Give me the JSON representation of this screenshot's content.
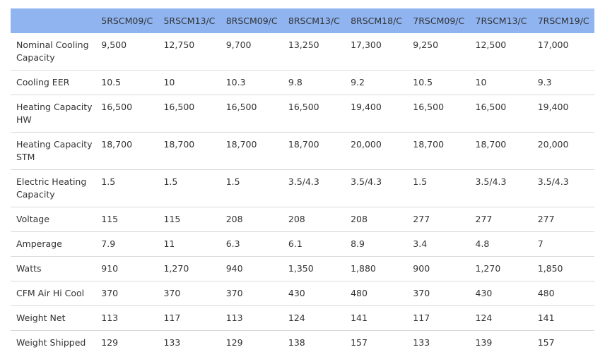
{
  "table": {
    "columns": [
      "",
      "5RSCM09/C",
      "5RSCM13/C",
      "8RSCM09/C",
      "8RSCM13/C",
      "8RSCM18/C",
      "7RSCM09/C",
      "7RSCM13/C",
      "7RSCM19/C"
    ],
    "rows": [
      {
        "label": "Nominal Cooling Capacity",
        "values": [
          "9,500",
          "12,750",
          "9,700",
          "13,250",
          "17,300",
          "9,250",
          "12,500",
          "17,000"
        ]
      },
      {
        "label": "Cooling EER",
        "values": [
          "10.5",
          "10",
          "10.3",
          "9.8",
          "9.2",
          "10.5",
          "10",
          "9.3"
        ]
      },
      {
        "label": "Heating Capacity HW",
        "values": [
          "16,500",
          "16,500",
          "16,500",
          "16,500",
          "19,400",
          "16,500",
          "16,500",
          "19,400"
        ]
      },
      {
        "label": "Heating Capacity STM",
        "values": [
          "18,700",
          "18,700",
          "18,700",
          "18,700",
          "20,000",
          "18,700",
          "18,700",
          "20,000"
        ]
      },
      {
        "label": "Electric Heating Capacity",
        "values": [
          "1.5",
          "1.5",
          "1.5",
          "3.5/4.3",
          "3.5/4.3",
          "1.5",
          "3.5/4.3",
          "3.5/4.3"
        ]
      },
      {
        "label": "Voltage",
        "values": [
          "115",
          "115",
          "208",
          "208",
          "208",
          "277",
          "277",
          "277"
        ]
      },
      {
        "label": "Amperage",
        "values": [
          "7.9",
          "11",
          "6.3",
          "6.1",
          "8.9",
          "3.4",
          "4.8",
          "7"
        ]
      },
      {
        "label": "Watts",
        "values": [
          "910",
          "1,270",
          "940",
          "1,350",
          "1,880",
          "900",
          "1,270",
          "1,850"
        ]
      },
      {
        "label": "CFM Air Hi Cool",
        "values": [
          "370",
          "370",
          "370",
          "430",
          "480",
          "370",
          "430",
          "480"
        ]
      },
      {
        "label": "Weight Net",
        "values": [
          "113",
          "117",
          "113",
          "124",
          "141",
          "117",
          "124",
          "141"
        ]
      },
      {
        "label": "Weight Shipped",
        "values": [
          "129",
          "133",
          "129",
          "138",
          "157",
          "133",
          "139",
          "157"
        ]
      }
    ]
  },
  "colors": {
    "header_bg": "#8fb4f0",
    "row_divider": "#d9d9d9",
    "text": "#333333"
  }
}
